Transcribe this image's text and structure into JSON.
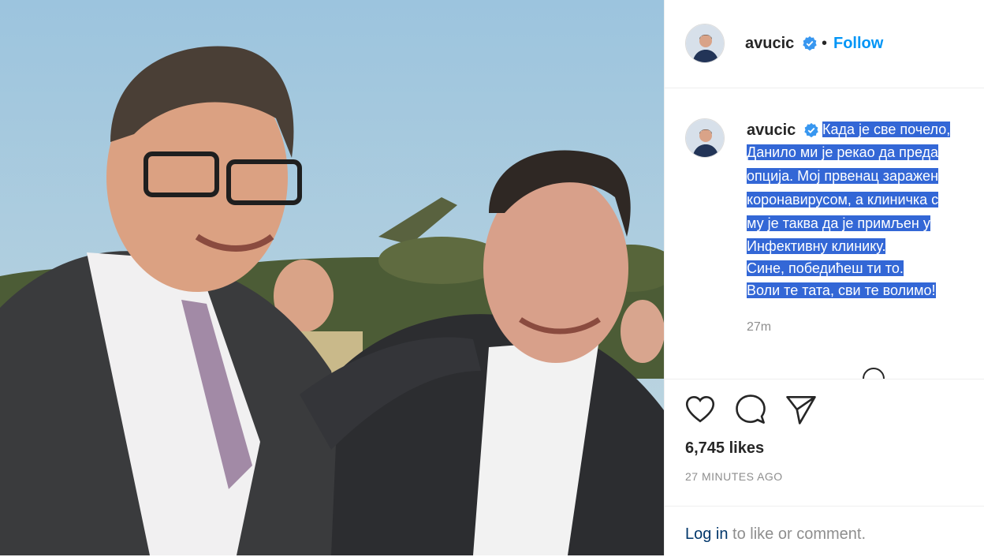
{
  "post": {
    "image_alt": "Photo",
    "author": {
      "username": "avucic",
      "verified": true,
      "follow_separator": "•",
      "follow_label": "Follow"
    },
    "caption": {
      "username": "avucic",
      "lines": [
        "Када је све почело, ",
        "Данило ми је рекао да преда",
        "опција. Мој првенац заражен",
        "коронавирусом, а клиничка с",
        "му је таква да је примљен у",
        "Инфективну клинику.",
        "Сине, победићеш ти то.",
        "Воли те тата, сви те волимо!"
      ],
      "time": "27m"
    },
    "actions": {
      "like_icon": "heart-icon",
      "comment_icon": "comment-icon",
      "share_icon": "paper-plane-icon"
    },
    "likes": "6,745 likes",
    "time_ago": "27 MINUTES AGO",
    "login": {
      "link": "Log in",
      "rest": " to like or comment."
    }
  }
}
